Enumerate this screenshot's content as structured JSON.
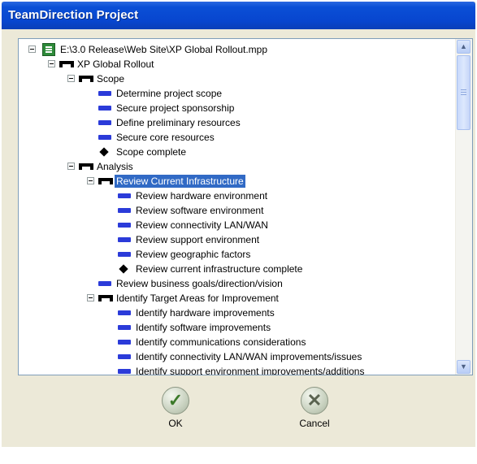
{
  "window": {
    "title": "TeamDirection Project"
  },
  "tree": {
    "rows": [
      {
        "label": "E:\\3.0 Release\\Web Site\\XP Global Rollout.mpp"
      },
      {
        "label": "XP Global Rollout"
      },
      {
        "label": "Scope"
      },
      {
        "label": "Determine project scope"
      },
      {
        "label": "Secure project sponsorship"
      },
      {
        "label": "Define preliminary resources"
      },
      {
        "label": "Secure core resources"
      },
      {
        "label": "Scope complete"
      },
      {
        "label": "Analysis"
      },
      {
        "label": "Review Current Infrastructure"
      },
      {
        "label": "Review hardware environment"
      },
      {
        "label": "Review software environment"
      },
      {
        "label": "Review connectivity LAN/WAN"
      },
      {
        "label": "Review support environment"
      },
      {
        "label": "Review geographic factors"
      },
      {
        "label": "Review current infrastructure complete"
      },
      {
        "label": "Review business goals/direction/vision"
      },
      {
        "label": "Identify Target Areas for Improvement"
      },
      {
        "label": "Identify hardware improvements"
      },
      {
        "label": "Identify software improvements"
      },
      {
        "label": "Identify communications considerations"
      },
      {
        "label": "Identify connectivity LAN/WAN improvements/issues"
      },
      {
        "label": "Identify support environment improvements/additions"
      }
    ],
    "selected": "Review Current Infrastructure"
  },
  "buttons": {
    "ok": "OK",
    "cancel": "Cancel"
  }
}
